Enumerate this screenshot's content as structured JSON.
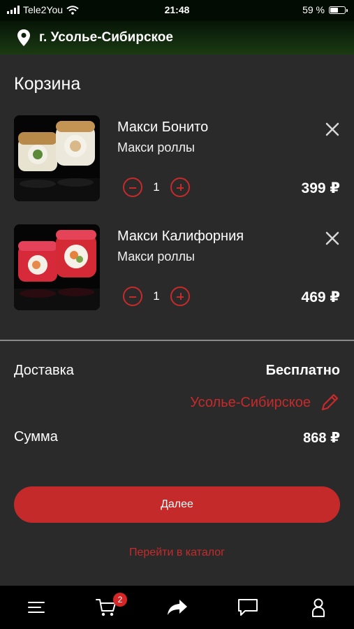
{
  "status_bar": {
    "carrier": "Tele2You",
    "time": "21:48",
    "battery": "59 %",
    "battery_level": 0.59
  },
  "location": {
    "city": "г. Усолье-Сибирское",
    "icon": "location-pin-icon"
  },
  "page_title": "Корзина",
  "cart_items": [
    {
      "name": "Макси Бонито",
      "category": "Макси роллы",
      "quantity": "1",
      "price": "399 ₽"
    },
    {
      "name": "Макси Калифорния",
      "category": "Макси роллы",
      "quantity": "1",
      "price": "469 ₽"
    }
  ],
  "delivery": {
    "label": "Доставка",
    "value": "Бесплатно",
    "address": "Усолье-Сибирское"
  },
  "total": {
    "label": "Сумма",
    "value": "868 ₽"
  },
  "next_button_label": "Далее",
  "catalog_link_label": "Перейти в каталог",
  "tab_bar": {
    "cart_badge": "2",
    "icons": [
      "menu-icon",
      "cart-icon",
      "share-icon",
      "chat-icon",
      "profile-icon"
    ]
  },
  "colors": {
    "accent": "#c62a2a",
    "background": "#2a2a2b",
    "tab_bar": "#000000"
  }
}
